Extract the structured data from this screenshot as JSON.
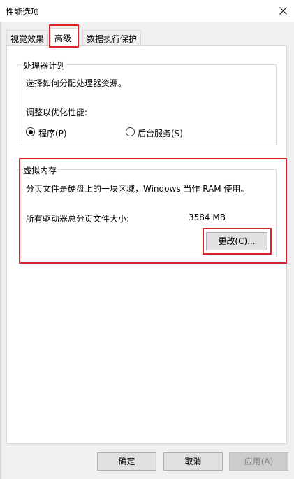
{
  "window": {
    "title": "性能选项",
    "close_icon": "close-icon"
  },
  "tabs": [
    {
      "label": "视觉效果",
      "active": false
    },
    {
      "label": "高级",
      "active": true
    },
    {
      "label": "数据执行保护",
      "active": false
    }
  ],
  "processor_group": {
    "title": "处理器计划",
    "description": "选择如何分配处理器资源。",
    "adjust_label": "调整以优化性能:",
    "options": [
      {
        "label": "程序(P)",
        "selected": true
      },
      {
        "label": "后台服务(S)",
        "selected": false
      }
    ]
  },
  "virtual_memory_group": {
    "title": "虚拟内存",
    "description": "分页文件是硬盘上的一块区域，Windows 当作 RAM 使用。",
    "total_label": "所有驱动器总分页文件大小:",
    "total_value": "3584 MB",
    "change_button": "更改(C)..."
  },
  "footer": {
    "ok_button": "确定",
    "cancel_button": "取消",
    "apply_button": "应用(A)"
  },
  "colors": {
    "highlight": "#d9262a",
    "panel_bg": "#ffffff",
    "window_bg": "#f0f0f0"
  }
}
